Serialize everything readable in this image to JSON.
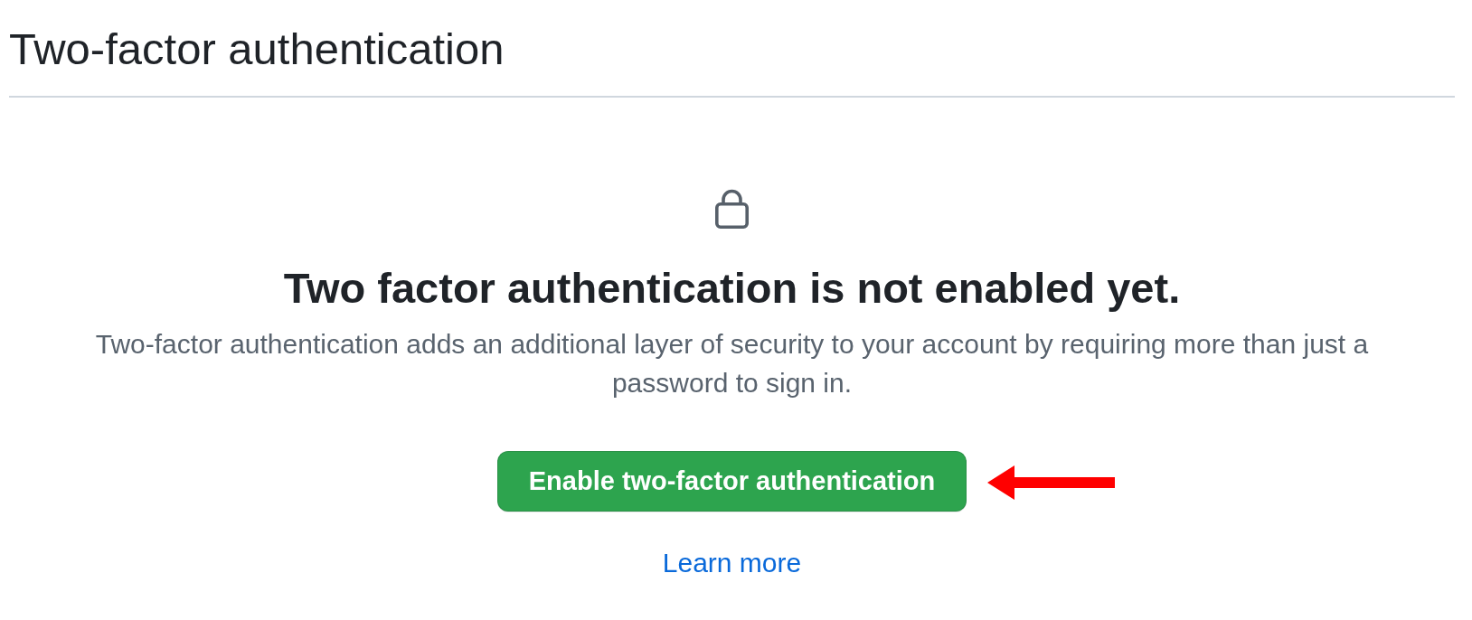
{
  "page": {
    "title": "Two-factor authentication"
  },
  "empty_state": {
    "heading": "Two factor authentication is not enabled yet.",
    "description": "Two-factor authentication adds an additional layer of security to your account by requiring more than just a password to sign in.",
    "primary_button": "Enable two-factor authentication",
    "link": "Learn more"
  }
}
